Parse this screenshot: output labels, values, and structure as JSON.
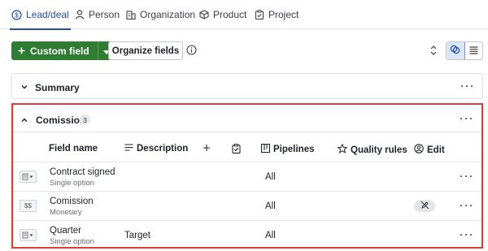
{
  "tabs": [
    {
      "label": "Lead/deal",
      "icon": "dollar-circle-icon",
      "active": true
    },
    {
      "label": "Person",
      "icon": "person-icon",
      "active": false
    },
    {
      "label": "Organization",
      "icon": "building-icon",
      "active": false
    },
    {
      "label": "Product",
      "icon": "box-icon",
      "active": false
    },
    {
      "label": "Project",
      "icon": "clipboard-icon",
      "active": false
    }
  ],
  "toolbar": {
    "custom_field_label": "Custom field",
    "organize_fields_label": "Organize fields"
  },
  "summary": {
    "title": "Summary"
  },
  "comission": {
    "title": "Comission",
    "count": "3",
    "columns": {
      "field_name": "Field name",
      "description": "Description",
      "pipelines": "Pipelines",
      "quality_rules": "Quality rules",
      "edit": "Edit"
    },
    "rows": [
      {
        "name": "Contract signed",
        "type": "Single option",
        "type_icon": "list-icon",
        "description": "",
        "pipelines": "All",
        "edit_icon": false
      },
      {
        "name": "Comission",
        "type": "Monetary",
        "type_icon": "$$",
        "description": "",
        "pipelines": "All",
        "edit_icon": true
      },
      {
        "name": "Quarter",
        "type": "Single option",
        "type_icon": "list-icon",
        "description": "Target",
        "pipelines": "All",
        "edit_icon": false
      }
    ]
  },
  "colors": {
    "primary_green": "#2e7d32",
    "active_tab": "#1f4fa8",
    "highlight_red": "#e03a3a"
  }
}
